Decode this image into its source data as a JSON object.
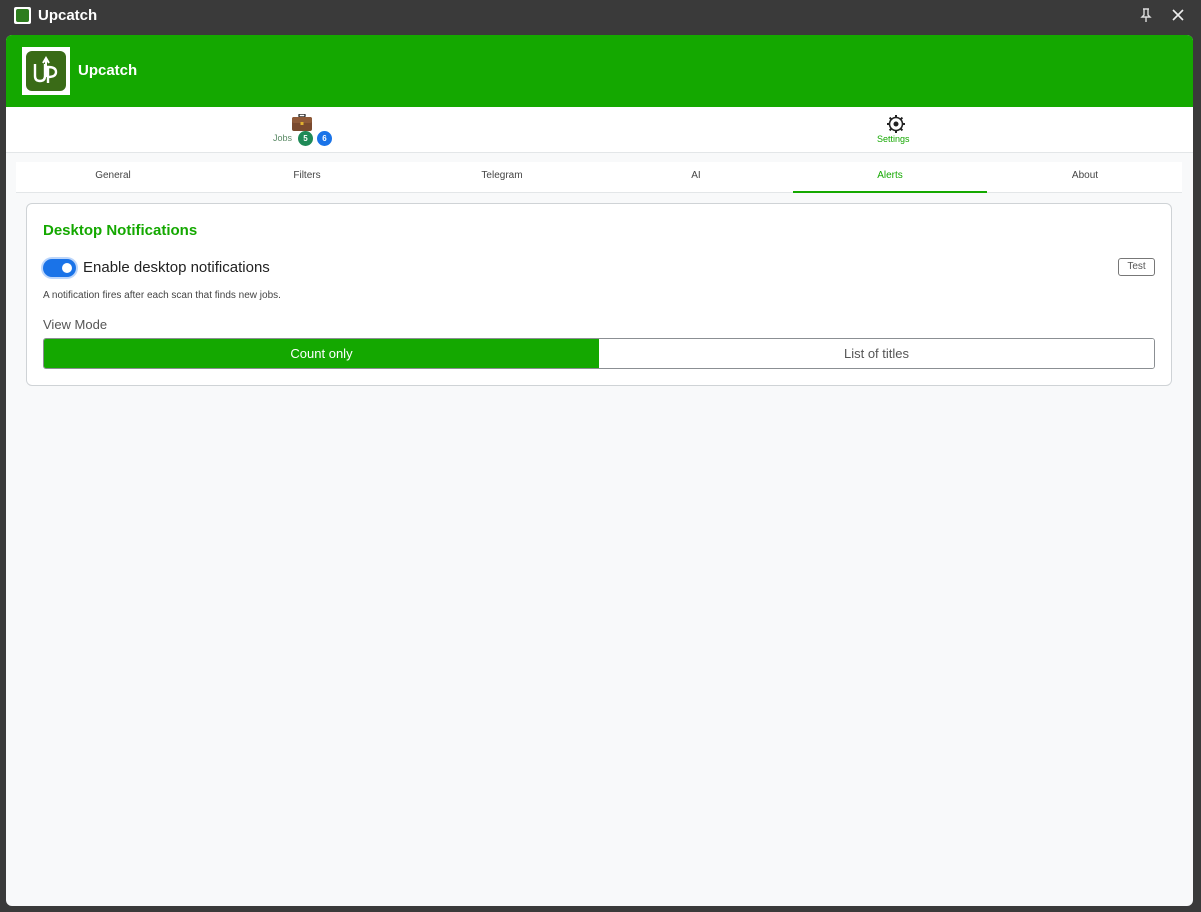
{
  "window": {
    "title": "Upcatch",
    "icons": [
      "app-icon",
      "pin-icon",
      "close-icon"
    ]
  },
  "header": {
    "brand": "Upcatch",
    "logo_icon": "upcatch-logo",
    "color": "#14a800"
  },
  "main_nav": {
    "jobs": {
      "label": "Jobs",
      "icon": "briefcase-icon",
      "badge_green": "5",
      "badge_blue": "6"
    },
    "settings": {
      "label": "Settings",
      "icon": "gear-icon",
      "active": true
    }
  },
  "subtabs": [
    {
      "label": "General"
    },
    {
      "label": "Filters"
    },
    {
      "label": "Telegram"
    },
    {
      "label": "AI"
    },
    {
      "label": "Alerts",
      "active": true
    },
    {
      "label": "About"
    }
  ],
  "alerts": {
    "section_title": "Desktop Notifications",
    "toggle_label": "Enable desktop notifications",
    "toggle_on": true,
    "test_label": "Test",
    "help_text": "A notification fires after each scan that finds new jobs.",
    "view_mode_label": "View Mode",
    "view_mode_options": [
      "Count only",
      "List of titles"
    ],
    "view_mode_selected": "Count only"
  },
  "colors": {
    "accent": "#14a800",
    "toggle": "#1a73e8",
    "badge_green": "#1f8a57",
    "badge_blue": "#1a73e8"
  }
}
